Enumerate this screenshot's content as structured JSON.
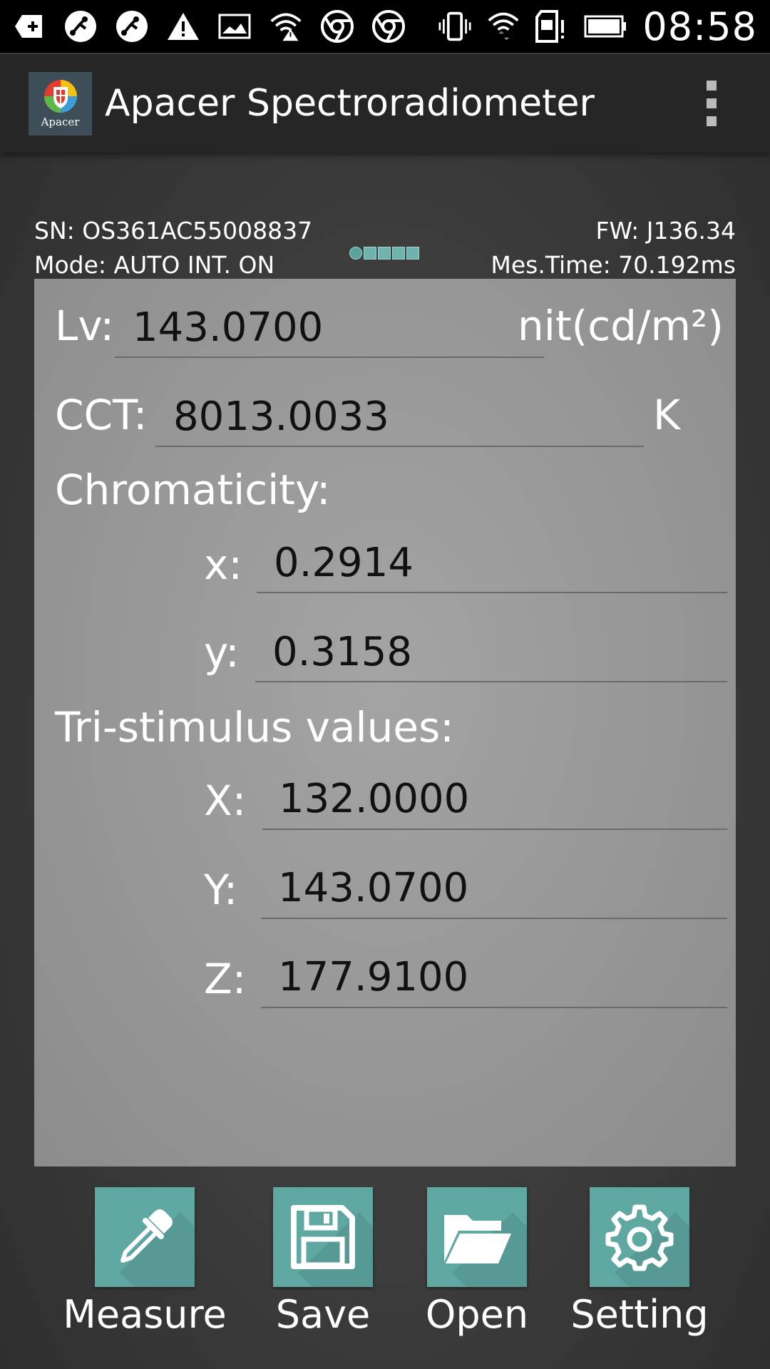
{
  "status_bar": {
    "time": "08:58"
  },
  "app_bar": {
    "logo_text": "Apacer",
    "title": "Apacer Spectroradiometer"
  },
  "device": {
    "sn": "SN: OS361AC55008837",
    "mode": "Mode: AUTO INT. ON",
    "fw": "FW: J136.34",
    "mes_time": "Mes.Time: 70.192ms"
  },
  "measurements": {
    "lv_label": "Lv:",
    "lv_value": "143.0700",
    "lv_unit": "nit(cd/m²)",
    "cct_label": "CCT:",
    "cct_value": "8013.0033",
    "cct_unit": "K",
    "chromaticity_heading": "Chromaticity:",
    "x_label": "x:",
    "x_value": "0.2914",
    "y_label": "y:",
    "y_value": "0.3158",
    "tristimulus_heading": "Tri-stimulus values:",
    "X_label": "X:",
    "X_value": "132.0000",
    "Y_label": "Y:",
    "Y_value": "143.0700",
    "Z_label": "Z:",
    "Z_value": "177.9100"
  },
  "toolbar": {
    "measure_label": "Measure",
    "save_label": "Save",
    "open_label": "Open",
    "setting_label": "Setting"
  },
  "colors": {
    "accent": "#5fa8a2",
    "panel": "#9a9a9a",
    "app_bar": "#262626"
  }
}
